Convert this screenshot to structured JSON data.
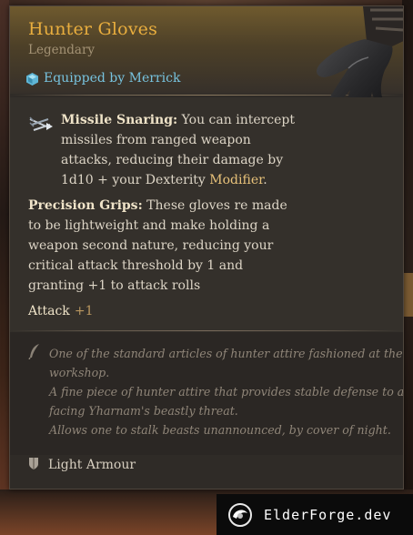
{
  "item": {
    "name": "Hunter Gloves",
    "rarity": "Legendary",
    "equipped": "Equipped by Merrick"
  },
  "abilities": {
    "missile_title": "Missile Snaring:",
    "missile_body": " You can intercept missiles from ranged weapon attacks, reducing their damage by 1d10 + your Dexterity ",
    "missile_modifier": "Modifier",
    "missile_end": ".",
    "precision_title": "Precision Grips:",
    "precision_body": " These gloves re made to be lightweight and make holding a weapon second nature, reducing your critical attack threshold by 1 and granting +1 to attack rolls"
  },
  "attack": {
    "label": "Attack",
    "value": "+1"
  },
  "lore": {
    "lines": [
      "One of the standard articles of hunter attire fashioned at the",
      "workshop.",
      "A fine piece of hunter attire that provides stable defense to anyone",
      "facing Yharnam's beastly threat.",
      "Allows one to stalk beasts unannounced, by cover of night."
    ]
  },
  "armour_type": "Light Armour",
  "watermark": "ElderForge.dev",
  "icons": {
    "equipped": "character-crystal-icon",
    "ability": "arrow-catch-icon",
    "lore": "quill-icon",
    "armour": "shield-icon",
    "item": "glove-image",
    "watermark": "elderforge-logo-icon"
  },
  "colors": {
    "name": "#e9ae3e",
    "equipped": "#77c3df",
    "modifier": "#e8c27a",
    "attack_value": "#b99760",
    "lore": "#8f8578"
  }
}
